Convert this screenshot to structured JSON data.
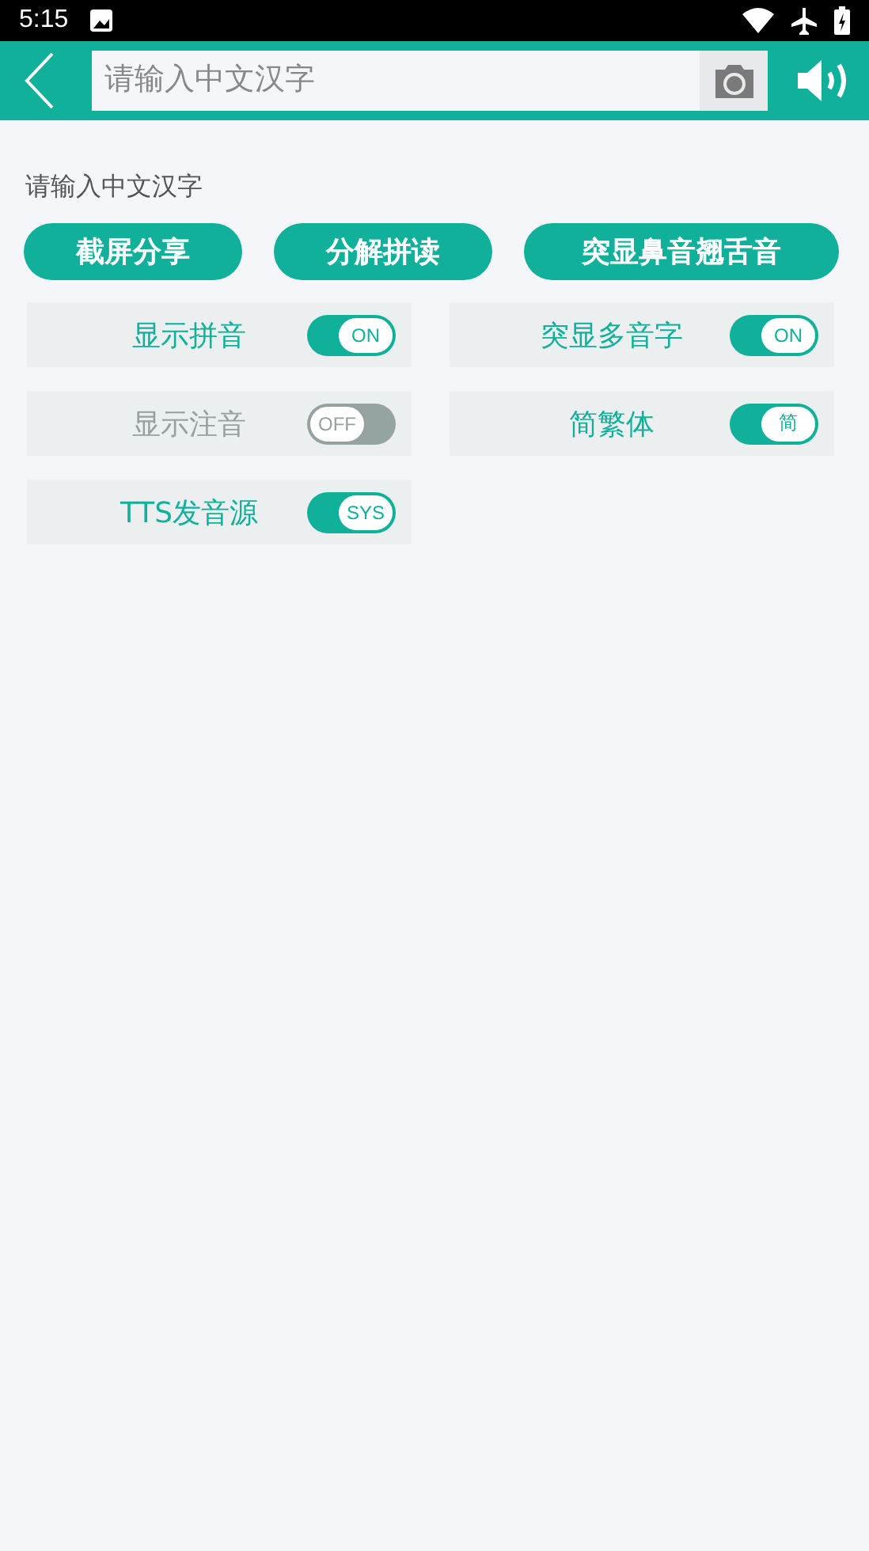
{
  "status_bar": {
    "time": "5:15"
  },
  "toolbar": {
    "search": {
      "placeholder": "请输入中文汉字"
    }
  },
  "hint": "请输入中文汉字",
  "buttons": [
    "截屏分享",
    "分解拼读",
    "突显鼻音翘舌音"
  ],
  "settings": [
    {
      "label": "显示拼音",
      "on": true,
      "switch_text": "ON"
    },
    {
      "label": "突显多音字",
      "on": true,
      "switch_text": "ON"
    },
    {
      "label": "显示注音",
      "on": false,
      "switch_text": "OFF"
    },
    {
      "label": "简繁体",
      "on": true,
      "switch_text": "简"
    },
    {
      "label": "TTS发音源",
      "on": true,
      "switch_text": "SYS"
    }
  ]
}
